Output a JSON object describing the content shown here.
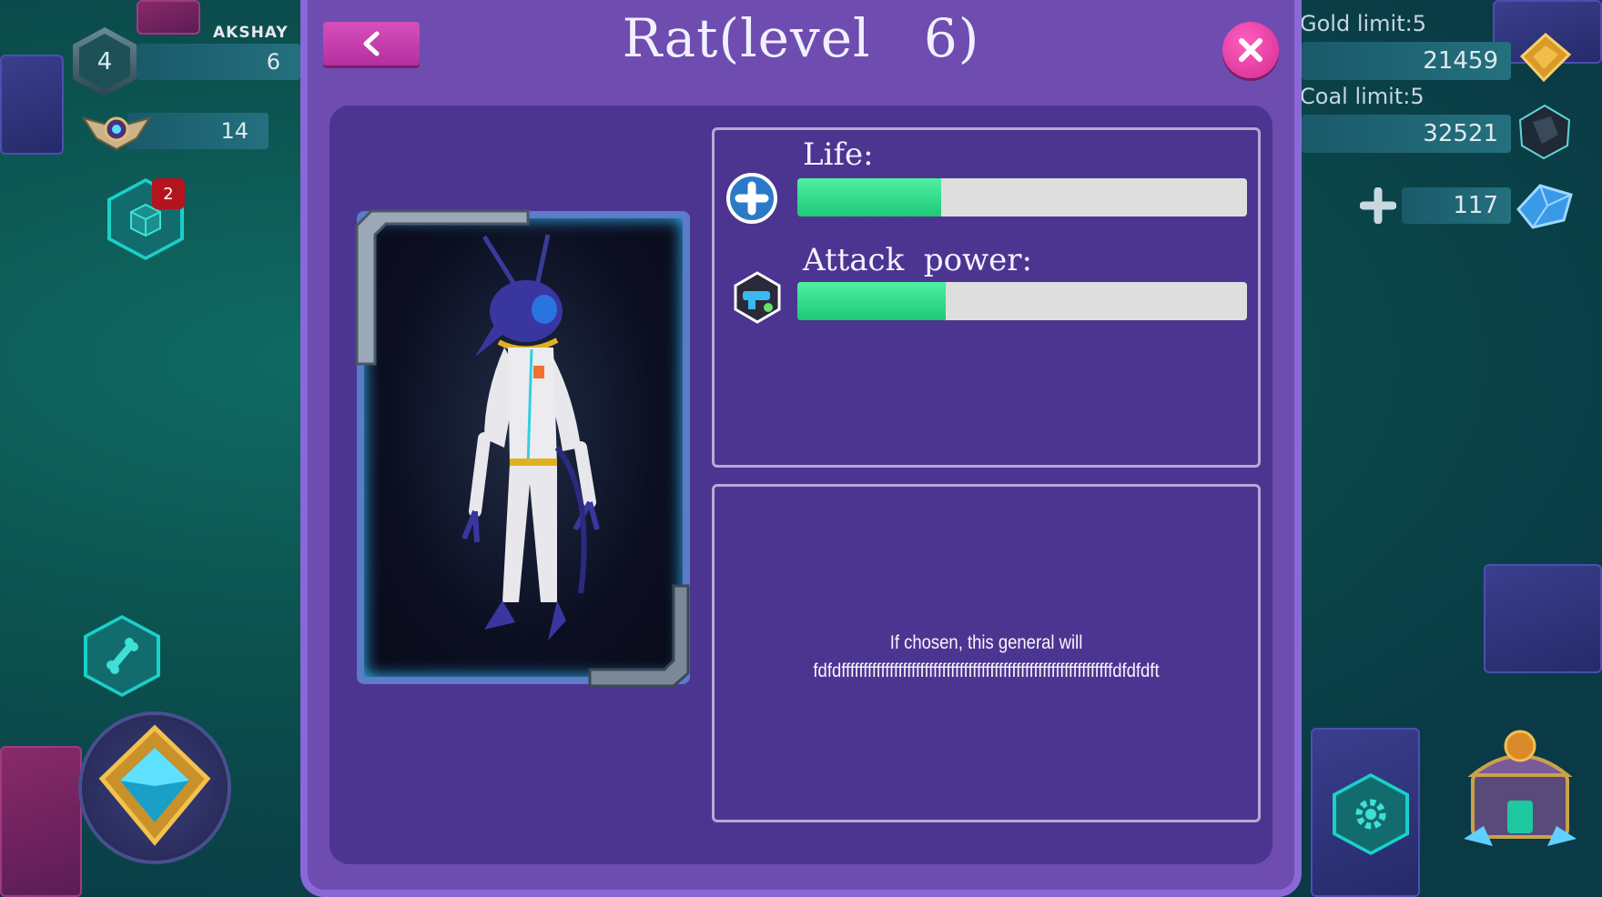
{
  "player": {
    "name": "AKSHAY",
    "level": "4",
    "xp_value": "6",
    "rank_value": "14",
    "inventory_badge": "2"
  },
  "resources": {
    "gold_label": "Gold limit:5",
    "gold_value": "21459",
    "coal_label": "Coal limit:5",
    "coal_value": "32521",
    "gems_value": "117"
  },
  "modal": {
    "title": "Rat(level   6)",
    "stats": [
      {
        "label": "Life:",
        "fraction": 0.32
      },
      {
        "label": "Attack  power:",
        "fraction": 0.33
      }
    ],
    "description_line1": "If chosen, this general will",
    "description_line2": "fdfdffffffffffffffffffffffffffffffffffffffffffffffffffffffffffffffdfdfdft"
  },
  "icons": {
    "back": "chevron-left-icon",
    "close": "close-icon",
    "life": "plus-icon",
    "attack": "blaster-icon",
    "gold": "gold-ingot-icon",
    "coal": "coal-icon",
    "gems": "crystal-icon"
  },
  "colors": {
    "accent": "#d64fbc",
    "panel": "#6e4cb0",
    "bar_fill": "#2fe08a"
  }
}
